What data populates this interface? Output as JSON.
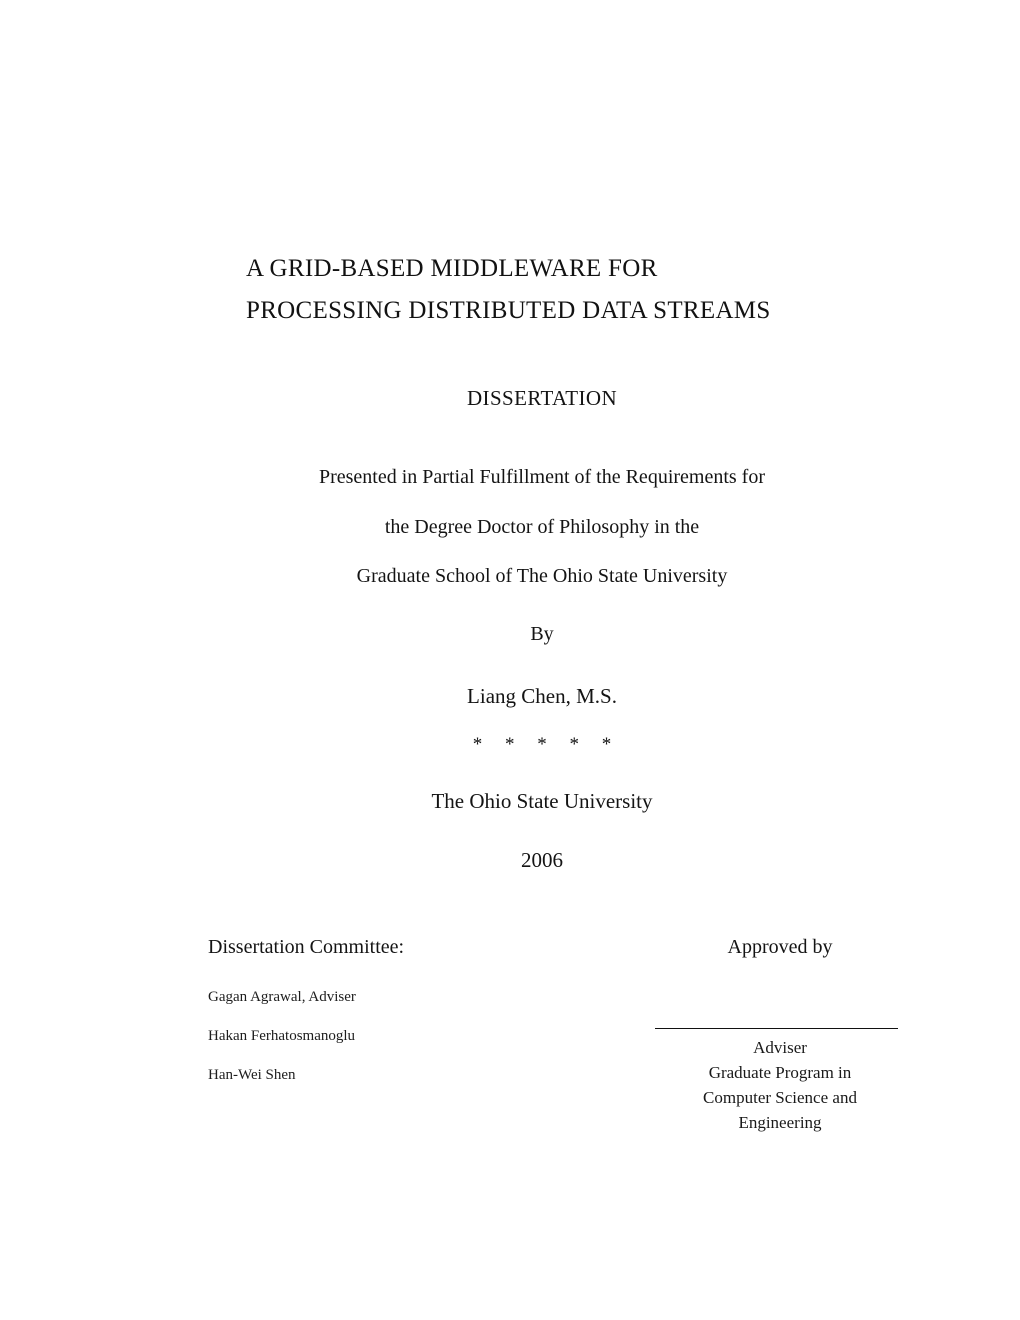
{
  "document": {
    "title_lines": [
      "A GRID-BASED MIDDLEWARE FOR",
      "PROCESSING DISTRIBUTED DATA STREAMS"
    ],
    "document_type": "DISSERTATION",
    "statement_lines": [
      "Presented in Partial Fulfillment of the Requirements for",
      "the Degree Doctor of Philosophy in the",
      "Graduate School of The Ohio State University"
    ],
    "by_word": "By",
    "author": "Liang Chen, M.S.",
    "separator": "* * * * *",
    "institution": "The Ohio State University",
    "year": "2006"
  },
  "committee": {
    "heading": "Dissertation Committee:",
    "members": [
      "Gagan Agrawal, Adviser",
      "Hakan Ferhatosmanoglu",
      "Han-Wei Shen"
    ]
  },
  "approval": {
    "heading": "Approved by",
    "adviser_label": "Adviser",
    "program_lines": [
      "Graduate Program in",
      "Computer Science and",
      "Engineering"
    ]
  },
  "colors": {
    "page_background": "#ffffff",
    "text": "#141414",
    "rule": "#111111"
  }
}
